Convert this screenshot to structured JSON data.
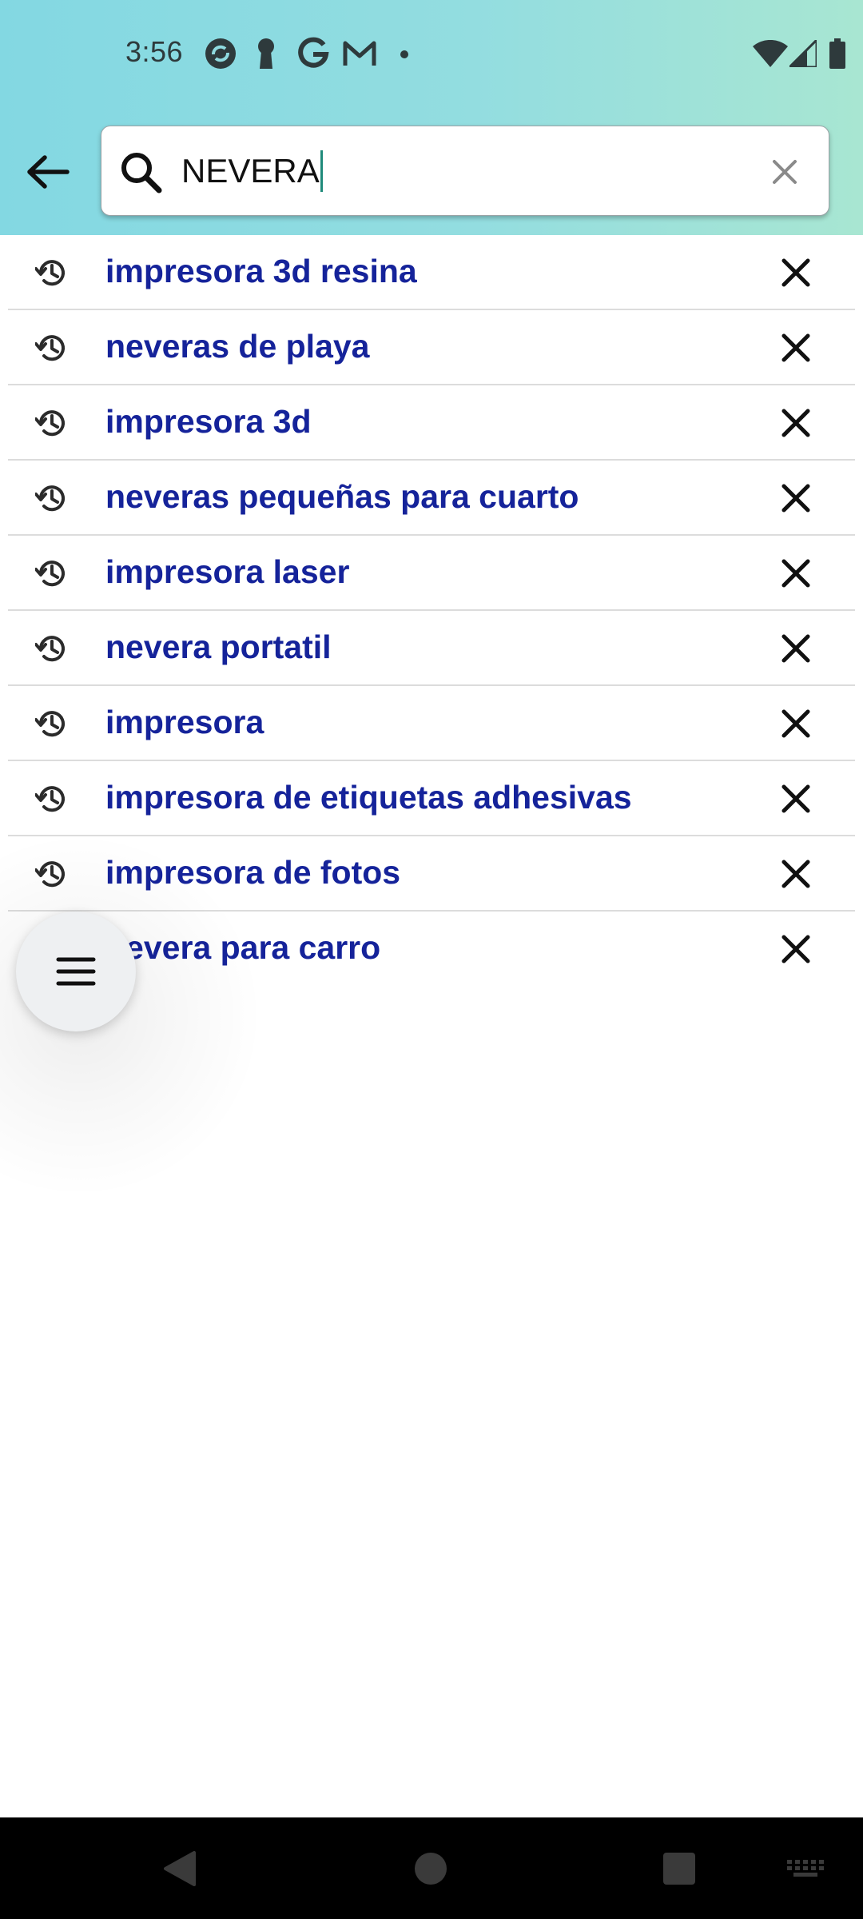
{
  "status_bar": {
    "time": "3:56",
    "left_icons": [
      "sync-icon",
      "keyhole-icon",
      "google-icon",
      "gmail-icon",
      "dot-icon"
    ],
    "right_icons": [
      "wifi-icon",
      "signal-icon",
      "battery-icon"
    ]
  },
  "search": {
    "value": "NEVERA",
    "back_icon": "arrow-left-icon",
    "search_icon": "search-icon",
    "clear_icon": "close-icon"
  },
  "suggestions": [
    {
      "text": "impresora 3d resina"
    },
    {
      "text": "neveras de playa"
    },
    {
      "text": "impresora 3d"
    },
    {
      "text": "neveras pequeñas para cuarto"
    },
    {
      "text": "impresora laser"
    },
    {
      "text": "nevera portatil"
    },
    {
      "text": "impresora"
    },
    {
      "text": "impresora de etiquetas adhesivas"
    },
    {
      "text": "impresora de fotos"
    },
    {
      "text": "nevera para carro"
    }
  ],
  "menu_button": {
    "icon": "hamburger-menu-icon"
  },
  "nav_bar": {
    "buttons": [
      "back-triangle-icon",
      "home-circle-icon",
      "recents-square-icon",
      "keyboard-icon"
    ]
  },
  "colors": {
    "suggestion_text": "#15239a",
    "header_gradient_start": "#83d8e2",
    "header_gradient_end": "#a8e6d2",
    "caret": "#1f8a7a"
  }
}
